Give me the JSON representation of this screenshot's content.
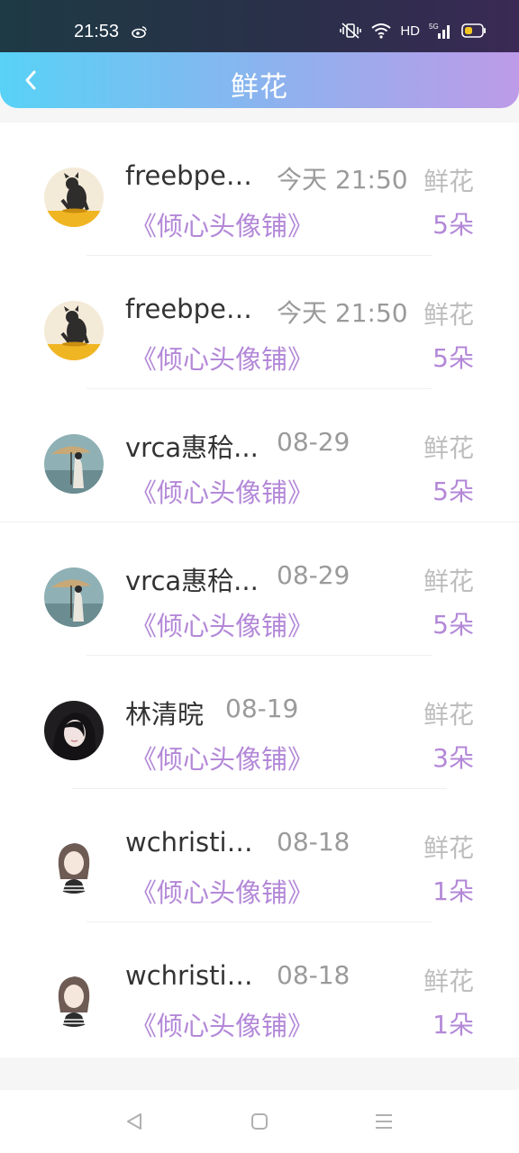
{
  "status_bar": {
    "time": "21:53",
    "network": "HD",
    "network_type": "5G"
  },
  "header": {
    "title": "鲜花"
  },
  "records": [
    {
      "name": "freebpeo...",
      "time": "今天 21:50",
      "gift": "鲜花",
      "book": "《倾心头像铺》",
      "count": "5朵",
      "avatar": "cat-avatar"
    },
    {
      "name": "freebpeo...",
      "time": "今天 21:50",
      "gift": "鲜花",
      "book": "《倾心头像铺》",
      "count": "5朵",
      "avatar": "cat-avatar"
    },
    {
      "name": "vrca惠秴...",
      "time": "08-29",
      "gift": "鲜花",
      "book": "《倾心头像铺》",
      "count": "5朵",
      "avatar": "umbrella-avatar"
    },
    {
      "name": "vrca惠秴...",
      "time": "08-29",
      "gift": "鲜花",
      "book": "《倾心头像铺》",
      "count": "5朵",
      "avatar": "umbrella-avatar"
    },
    {
      "name": "林清晥",
      "time": "08-19",
      "gift": "鲜花",
      "book": "《倾心头像铺》",
      "count": "3朵",
      "avatar": "girl-avatar"
    },
    {
      "name": "wchristia...",
      "time": "08-18",
      "gift": "鲜花",
      "book": "《倾心头像铺》",
      "count": "1朵",
      "avatar": "sketch-avatar"
    },
    {
      "name": "wchristia...",
      "time": "08-18",
      "gift": "鲜花",
      "book": "《倾心头像铺》",
      "count": "1朵",
      "avatar": "sketch-avatar"
    }
  ],
  "colors": {
    "accent": "#b388d8",
    "header_start": "#58d2f6",
    "header_end": "#bd9be8"
  }
}
